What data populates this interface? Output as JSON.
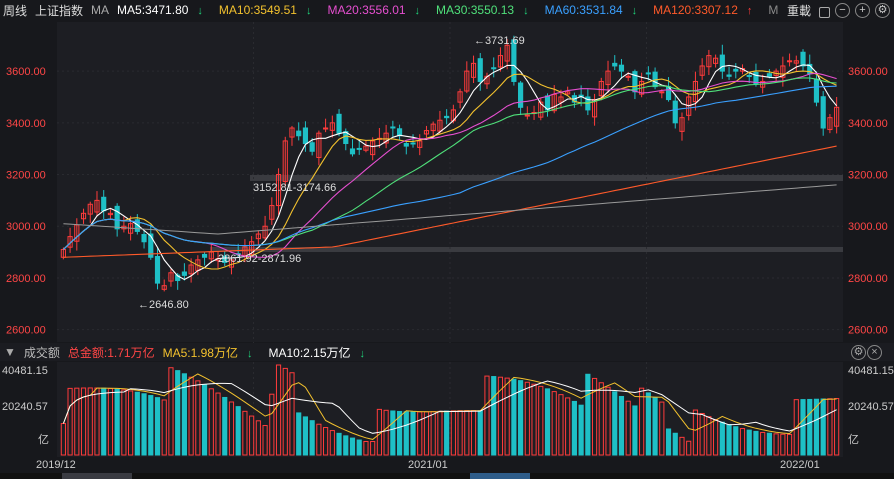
{
  "topbar": {
    "period": "周线",
    "index_name": "上证指数",
    "ma_label": "MA",
    "ma5": "MA5:3471.80",
    "ma10": "MA10:3549.51",
    "ma20": "MA20:3556.01",
    "ma30": "MA30:3550.13",
    "ma60": "MA60:3531.84",
    "ma120": "MA120:3307.12",
    "ma_more": "M",
    "reset": "重載"
  },
  "price_axis": {
    "ticks": [
      "3600.00",
      "3400.00",
      "3200.00",
      "3000.00",
      "2800.00",
      "2600.00"
    ]
  },
  "annotations": {
    "high": "←3731.69",
    "low": "←2646.80",
    "gap_upper": "3152.81-3174.66",
    "gap_lower": "2861.92-2871.96"
  },
  "volume": {
    "title": "成交额",
    "total": "总金额:1.71万亿",
    "ma5": "MA5:1.98万亿",
    "ma10": "MA10:2.15万亿",
    "ticks": [
      "40481.15",
      "20240.57",
      "亿"
    ]
  },
  "x_axis": [
    "2019/12",
    "2021/01",
    "2022/01"
  ],
  "colors": {
    "up": "#ff3b3b",
    "down": "#1ec0c6",
    "ma5": "#ffffff",
    "ma10": "#f2c12e",
    "ma20": "#e64fd0",
    "ma30": "#4fe07a",
    "ma60": "#3aa0ff",
    "ma120": "#ff5a2a",
    "ma250": "#9a9a9a"
  },
  "chart_data": {
    "type": "candlestick",
    "ylim": [
      2560,
      3790
    ],
    "closes": [
      2910,
      2960,
      3005,
      3050,
      3085,
      3100,
      3060,
      3050,
      2990,
      3000,
      3010,
      2980,
      2940,
      2880,
      2780,
      2770,
      2820,
      2790,
      2810,
      2850,
      2870,
      2880,
      2900,
      2875,
      2860,
      2870,
      2890,
      2920,
      2940,
      2970,
      3000,
      3080,
      3200,
      3330,
      3380,
      3350,
      3320,
      3290,
      3360,
      3380,
      3400,
      3360,
      3320,
      3280,
      3300,
      3310,
      3330,
      3340,
      3360,
      3380,
      3350,
      3310,
      3320,
      3330,
      3370,
      3395,
      3410,
      3420,
      3450,
      3520,
      3600,
      3630,
      3560,
      3580,
      3610,
      3660,
      3700,
      3560,
      3460,
      3430,
      3440,
      3480,
      3450,
      3510,
      3500,
      3520,
      3480,
      3500,
      3450,
      3490,
      3560,
      3600,
      3620,
      3600,
      3580,
      3520,
      3560,
      3590,
      3540,
      3520,
      3490,
      3400,
      3420,
      3500,
      3560,
      3620,
      3660,
      3650,
      3600,
      3580,
      3600,
      3610,
      3580,
      3550,
      3560,
      3580,
      3600,
      3620,
      3640,
      3640,
      3620,
      3590,
      3480,
      3380,
      3420,
      3460
    ]
  }
}
